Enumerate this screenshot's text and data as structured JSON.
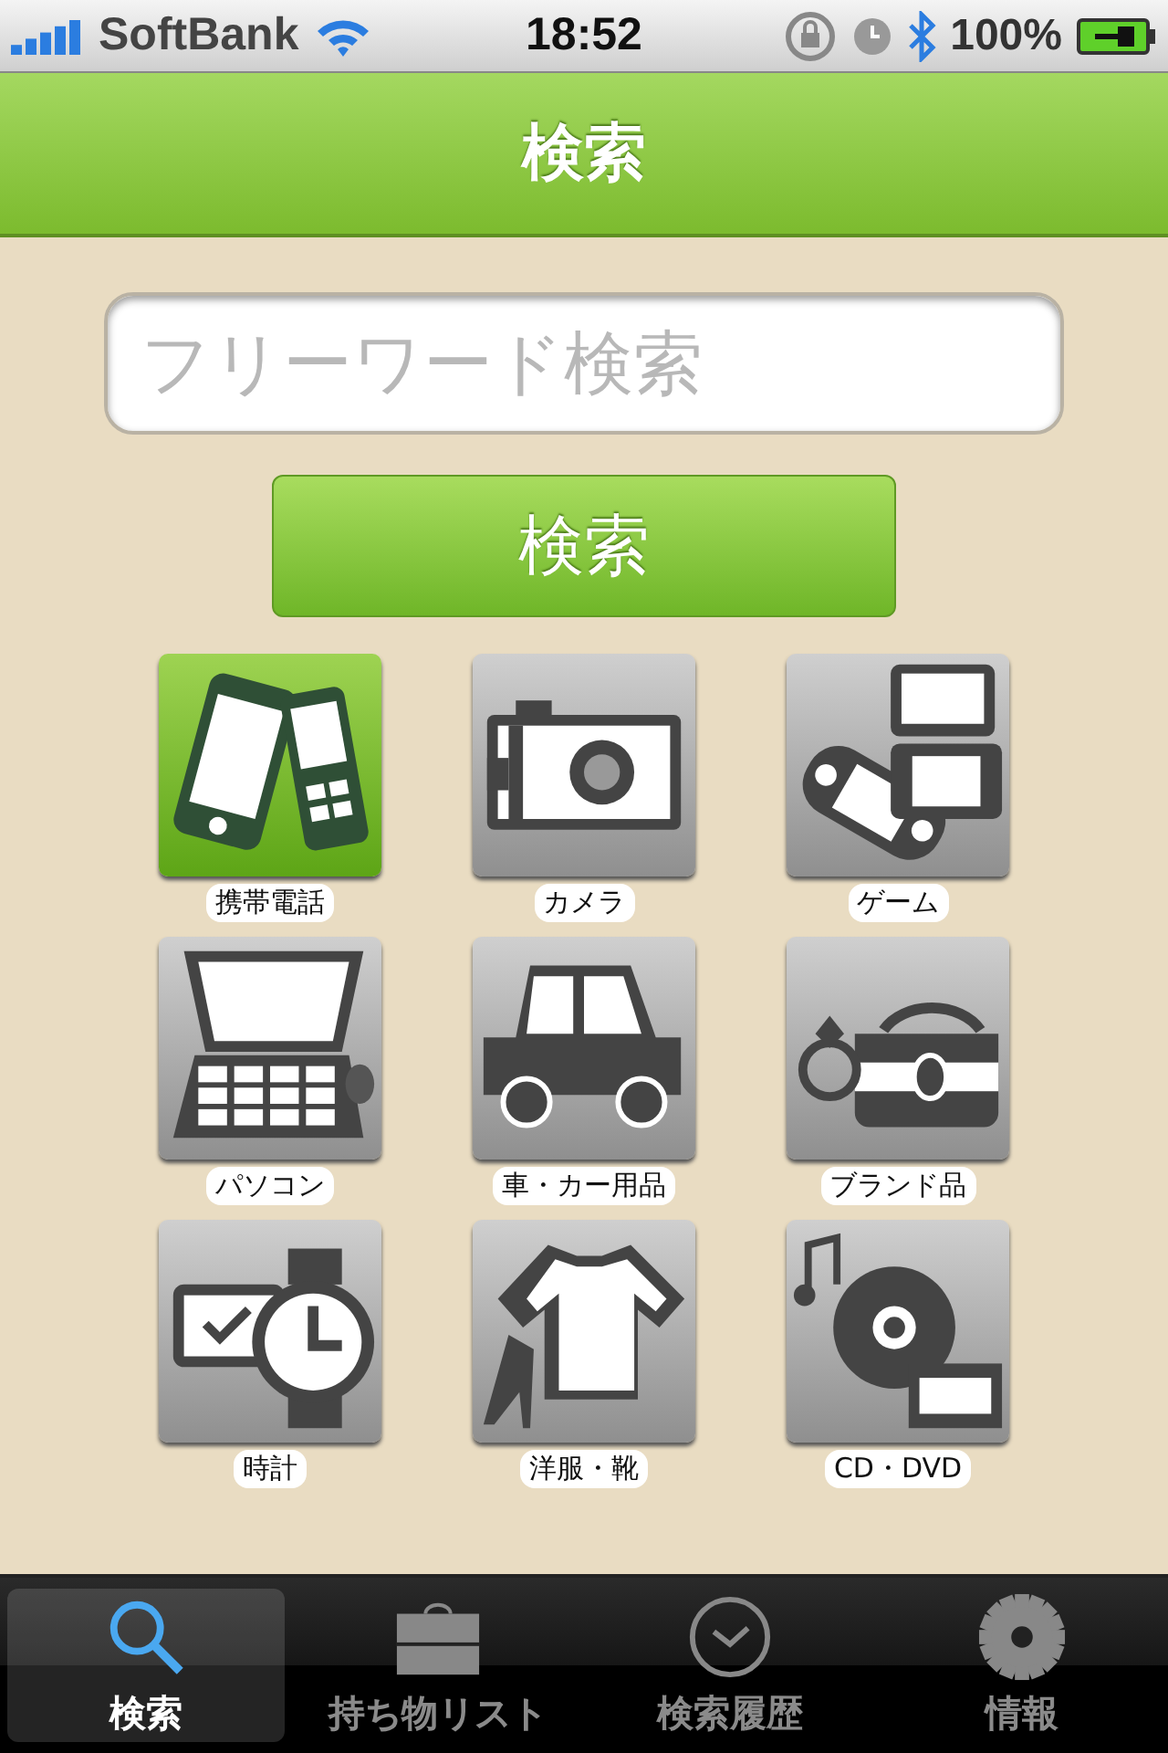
{
  "status_bar": {
    "carrier": "SoftBank",
    "time": "18:52",
    "battery": "100%"
  },
  "header": {
    "title": "検索"
  },
  "search": {
    "placeholder": "フリーワード検索",
    "button": "検索"
  },
  "categories": [
    {
      "label": "携帯電話",
      "kind": "phone",
      "selected": true
    },
    {
      "label": "カメラ",
      "kind": "camera",
      "selected": false
    },
    {
      "label": "ゲーム",
      "kind": "game",
      "selected": false
    },
    {
      "label": "パソコン",
      "kind": "pc",
      "selected": false
    },
    {
      "label": "車・カー用品",
      "kind": "car",
      "selected": false
    },
    {
      "label": "ブランド品",
      "kind": "bag",
      "selected": false
    },
    {
      "label": "時計",
      "kind": "watch",
      "selected": false
    },
    {
      "label": "洋服・靴",
      "kind": "clothes",
      "selected": false
    },
    {
      "label": "CD・DVD",
      "kind": "disc",
      "selected": false
    }
  ],
  "tabs": [
    {
      "label": "検索",
      "kind": "search",
      "selected": true
    },
    {
      "label": "持ち物リスト",
      "kind": "case",
      "selected": false
    },
    {
      "label": "検索履歴",
      "kind": "clock",
      "selected": false
    },
    {
      "label": "情報",
      "kind": "gear",
      "selected": false
    }
  ]
}
